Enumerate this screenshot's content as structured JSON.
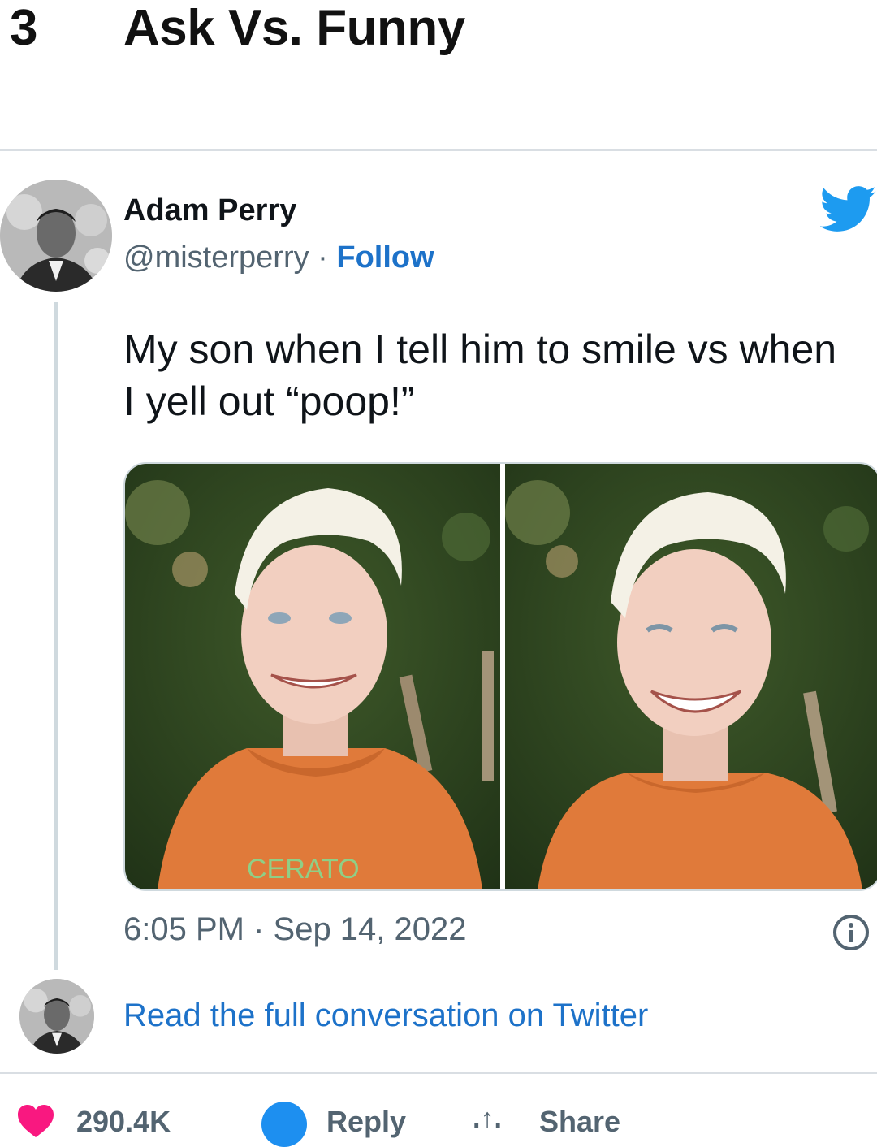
{
  "header": {
    "rank": "3",
    "title": "Ask Vs. Funny"
  },
  "tweet": {
    "author_name": "Adam Perry",
    "handle": "@misterperry",
    "separator": " · ",
    "follow_label": "Follow",
    "text": "My son when I tell him to smile vs when I yell out “poop!”",
    "timestamp": "6:05 PM · Sep 14, 2022",
    "shirt_text": "CERATO"
  },
  "footer": {
    "read_link": "Read the full conversation on Twitter",
    "likes": "290.4K",
    "reply_label": "Reply",
    "share_label": "Share"
  },
  "colors": {
    "twitter_blue": "#1d9bf0",
    "link_blue": "#1d72c9",
    "like_pink": "#f91880",
    "muted": "#536471"
  },
  "icons": {
    "brand": "twitter-bird-icon",
    "info": "info-icon",
    "like": "heart-icon",
    "reply": "reply-bubble-icon",
    "share": "share-arrow-icon"
  }
}
